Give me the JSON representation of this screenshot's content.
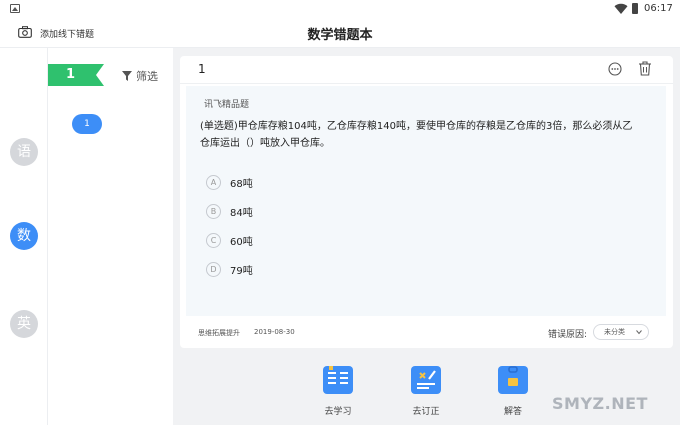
{
  "status_bar": {
    "time": "06:17"
  },
  "header": {
    "add_offline_label": "添加线下错题",
    "title": "数学错题本"
  },
  "subjects": [
    {
      "label": "语",
      "active": false
    },
    {
      "label": "数",
      "active": true
    },
    {
      "label": "英",
      "active": false
    }
  ],
  "list": {
    "count_badge": "1",
    "filter_label": "筛选",
    "question_pill": "1"
  },
  "question": {
    "number": "1",
    "source": "讯飞精品题",
    "text": "(单选题)甲仓库存粮104吨，乙仓库存粮140吨，要使甲仓库的存粮是乙仓库的3倍，那么必须从乙仓库运出（）吨放入甲仓库。",
    "options": [
      {
        "letter": "A",
        "text": "68吨"
      },
      {
        "letter": "B",
        "text": "84吨"
      },
      {
        "letter": "C",
        "text": "60吨"
      },
      {
        "letter": "D",
        "text": "79吨"
      }
    ],
    "tag": "思维拓展提升",
    "date": "2019-08-30",
    "error_reason_label": "错误原因:",
    "error_reason_value": "未分类"
  },
  "actions": [
    {
      "label": "去学习",
      "icon": "book-icon"
    },
    {
      "label": "去订正",
      "icon": "correct-icon"
    },
    {
      "label": "解答",
      "icon": "bag-icon"
    }
  ],
  "watermark": "SMYZ.NET",
  "colors": {
    "accent_blue": "#3d8ef7",
    "flag_green": "#2fc16e",
    "inactive_subject": "#d5d7db"
  }
}
